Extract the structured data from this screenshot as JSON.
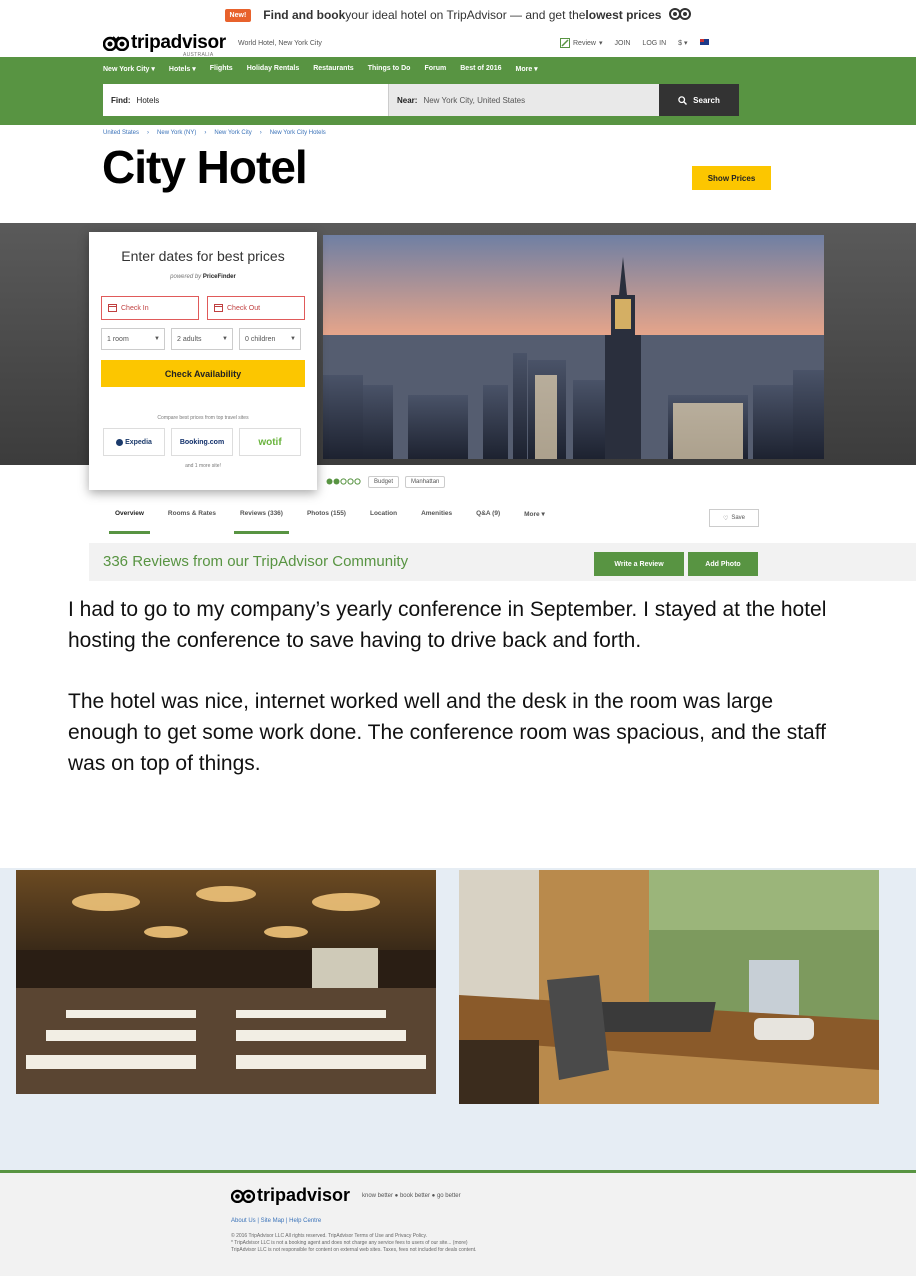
{
  "promo": {
    "badge": "New!",
    "text_pre": "Find and book",
    "text_mid": " your ideal hotel on TripAdvisor — and get the ",
    "text_bold": "lowest prices"
  },
  "header": {
    "logo": "tripadvisor",
    "logo_sub": "AUSTRALIA",
    "location": "World Hotel, New York City",
    "review": "Review",
    "join": "JOIN",
    "login": "LOG IN",
    "currency": "$"
  },
  "nav": {
    "items": [
      "New York City ▾",
      "Hotels ▾",
      "Flights",
      "Holiday Rentals",
      "Restaurants",
      "Things to Do",
      "Forum",
      "Best of 2016",
      "More ▾"
    ]
  },
  "search": {
    "find_label": "Find:",
    "find_value": "Hotels",
    "near_label": "Near:",
    "near_value": "New York City, United States",
    "button": "Search"
  },
  "breadcrumb": [
    "United States",
    "›",
    "New York (NY)",
    "›",
    "New York City",
    "›",
    "New York City Hotels"
  ],
  "hotel": {
    "name": "City Hotel",
    "show_prices": "Show Prices"
  },
  "booking": {
    "title": "Enter dates for best prices",
    "powered_by": "powered by",
    "powered_brand": "PriceFinder",
    "check_in": "Check In",
    "check_out": "Check Out",
    "rooms": "1 room",
    "adults": "2 adults",
    "children": "0 children",
    "check_button": "Check Availability",
    "compare_text": "Compare best prices from top travel sites",
    "partners": [
      "Expedia",
      "Booking.com",
      "wotif"
    ],
    "more_sites": "and 1 more site!"
  },
  "rating_row": {
    "tags": [
      "Budget",
      "Manhattan"
    ]
  },
  "tabs": [
    "Overview",
    "Rooms & Rates",
    "Reviews (336)",
    "Photos (155)",
    "Location",
    "Amenities",
    "Q&A (9)",
    "More ▾"
  ],
  "save_label": "Save",
  "reviews": {
    "heading": "336 Reviews from our TripAdvisor Community",
    "write_review": "Write a Review",
    "add_photo": "Add Photo"
  },
  "review_text": {
    "p1": "I had to go to my company’s yearly conference in September.  I stayed at the hotel hosting the conference to save having to drive back and forth.",
    "p2": "The hotel was nice, internet worked well and the desk in the room was large enough to get some work done.  The conference room was spacious, and the staff was on top of things."
  },
  "footer": {
    "logo": "tripadvisor",
    "tagline": "know better ● book better ● go better",
    "links": "About Us | Site Map | Help Centre",
    "legal1": "© 2016 TripAdvisor LLC All rights reserved. TripAdvisor Terms of Use and Privacy Policy.",
    "legal2": "* TripAdvisor LLC is not a booking agent and does not charge any service fees to users of our site... (more)",
    "legal3": "TripAdvisor LLC is not responsible for content on external web sites. Taxes, fees not included for deals content."
  },
  "colors": {
    "green": "#589442",
    "yellow": "#fcc600",
    "link": "#3b73b9"
  }
}
